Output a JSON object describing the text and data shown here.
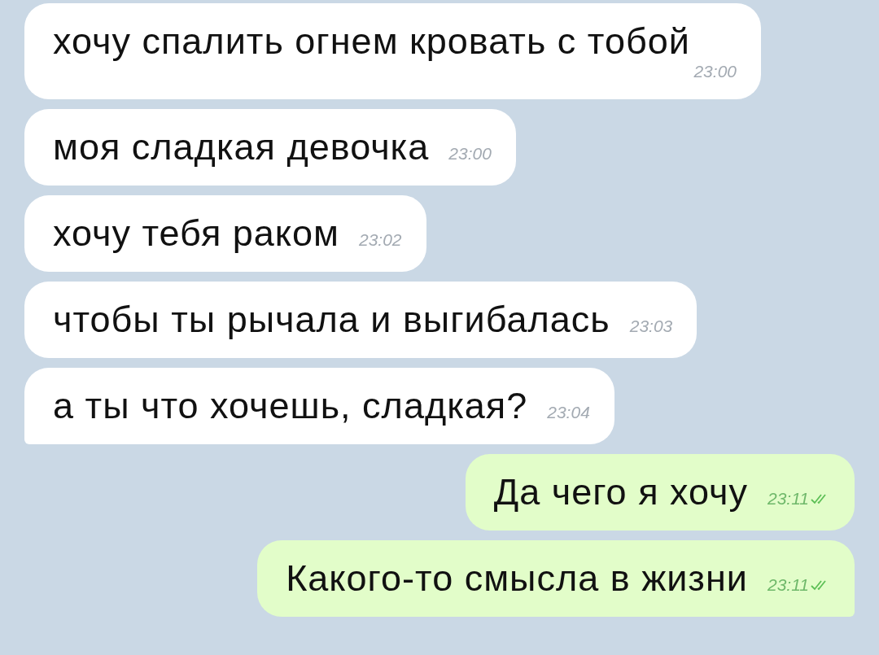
{
  "messages": [
    {
      "kind": "in",
      "text": "хочу спалить огнем кровать с тобой",
      "time": "23:00",
      "tail": false
    },
    {
      "kind": "in",
      "text": "моя сладкая девочка",
      "time": "23:00",
      "tail": false
    },
    {
      "kind": "in",
      "text": "хочу тебя раком",
      "time": "23:02",
      "tail": false
    },
    {
      "kind": "in",
      "text": "чтобы ты рычала и выгибалась",
      "time": "23:03",
      "tail": false
    },
    {
      "kind": "in",
      "text": "а ты что хочешь, сладкая?",
      "time": "23:04",
      "tail": true
    },
    {
      "kind": "out",
      "text": "Да чего я хочу",
      "time": "23:11",
      "read": true,
      "tail": false
    },
    {
      "kind": "out",
      "text": "Какого-то смысла в жизни",
      "time": "23:11",
      "read": true,
      "tail": true
    }
  ]
}
